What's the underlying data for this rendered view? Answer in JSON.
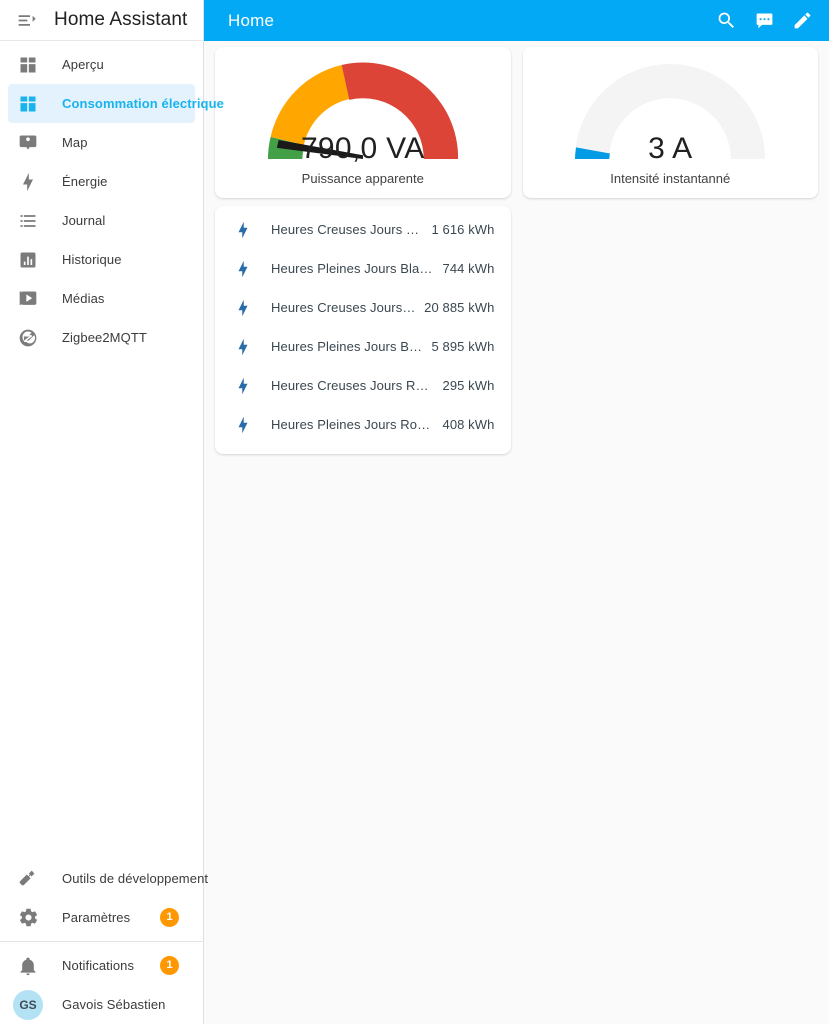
{
  "sidebar": {
    "title": "Home Assistant",
    "menu_icon": "menu-open-icon",
    "items": [
      {
        "label": "Aperçu",
        "icon": "view-dashboard-icon",
        "active": false
      },
      {
        "label": "Consommation électrique",
        "icon": "view-dashboard-icon",
        "active": true
      },
      {
        "label": "Map",
        "icon": "account-badge-icon",
        "active": false
      },
      {
        "label": "Énergie",
        "icon": "lightning-bolt-icon",
        "active": false
      },
      {
        "label": "Journal",
        "icon": "format-list-bulleted-icon",
        "active": false
      },
      {
        "label": "Historique",
        "icon": "chart-box-icon",
        "active": false
      },
      {
        "label": "Médias",
        "icon": "play-box-multiple-icon",
        "active": false
      },
      {
        "label": "Zigbee2MQTT",
        "icon": "zigbee-icon",
        "active": false
      }
    ],
    "bottom_items": [
      {
        "label": "Outils de développement",
        "icon": "hammer-icon",
        "badge": ""
      },
      {
        "label": "Paramètres",
        "icon": "cog-icon",
        "badge": "1"
      }
    ],
    "footer_items": [
      {
        "label": "Notifications",
        "icon": "bell-icon",
        "badge": "1"
      }
    ],
    "user": {
      "label": "Gavois Sébastien",
      "initials": "GS"
    }
  },
  "topbar": {
    "title": "Home",
    "actions": [
      {
        "name": "search-icon",
        "label": "Rechercher"
      },
      {
        "name": "assist-icon",
        "label": "Assist"
      },
      {
        "name": "pencil-icon",
        "label": "Modifier"
      }
    ]
  },
  "cards": {
    "gauge_power": {
      "value": "790,0 VA",
      "label": "Puissance apparente",
      "needle_angle_deg": 13,
      "segments": [
        {
          "name": "green",
          "from_deg": 0,
          "to_deg": 31,
          "color": "#43a047"
        },
        {
          "name": "orange",
          "from_deg": 31,
          "to_deg": 77,
          "color": "#ffa600"
        },
        {
          "name": "red",
          "from_deg": 77,
          "to_deg": 180,
          "color": "#db4437"
        }
      ],
      "needle_color": "#000000"
    },
    "gauge_current": {
      "value": "3 A",
      "label": "Intensité instantanné",
      "fill_to_deg": 7,
      "fill_color": "#039be5",
      "track_color": "#f4f4f4"
    },
    "entities": {
      "rows": [
        {
          "icon": "lightning-bolt-icon",
          "name": "Heures Creuses Jours Blancs",
          "value": "1 616 kWh"
        },
        {
          "icon": "lightning-bolt-icon",
          "name": "Heures Pleines Jours Blancs",
          "value": "744 kWh"
        },
        {
          "icon": "lightning-bolt-icon",
          "name": "Heures Creuses Jours Bleus",
          "value": "20 885 kWh"
        },
        {
          "icon": "lightning-bolt-icon",
          "name": "Heures Pleines Jours Bleus",
          "value": "5 895 kWh"
        },
        {
          "icon": "lightning-bolt-icon",
          "name": "Heures Creuses Jours Rouges",
          "value": "295 kWh"
        },
        {
          "icon": "lightning-bolt-icon",
          "name": "Heures Pleines Jours Rouges",
          "value": "408 kWh"
        }
      ]
    }
  },
  "colors": {
    "accent": "#03a9f4",
    "active_bg": "#e3f2fd",
    "badge": "#ff9800",
    "background": "#fafafa"
  }
}
